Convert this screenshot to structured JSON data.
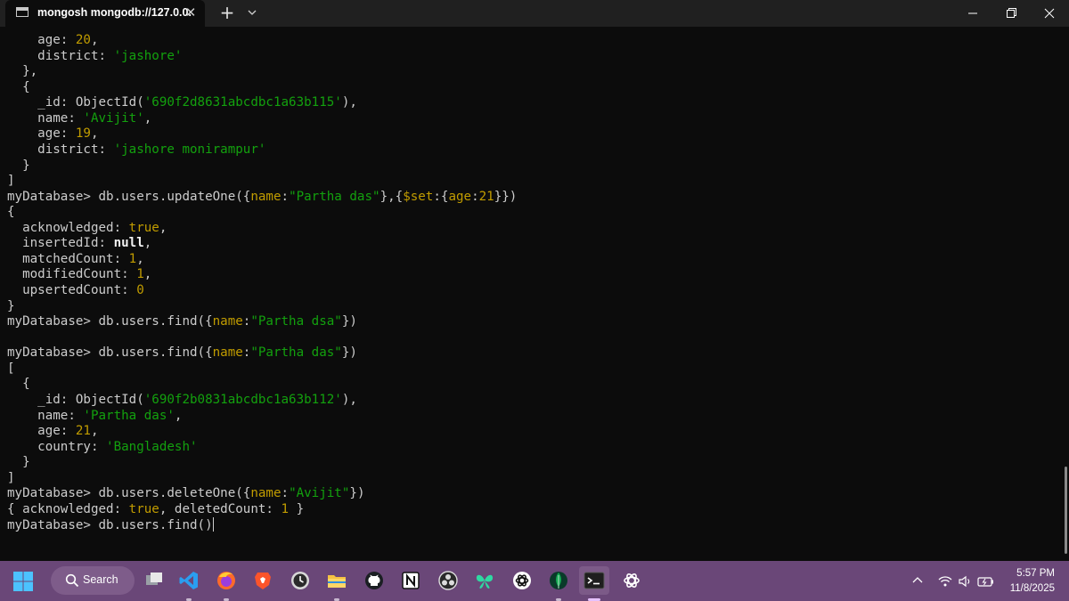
{
  "window": {
    "tab_title": "mongosh mongodb://127.0.0.",
    "close_tab_glyph": "✕",
    "new_tab_glyph": "+"
  },
  "terminal": {
    "lines": [
      [
        {
          "t": "    age: "
        },
        {
          "t": "20",
          "c": "num"
        },
        {
          "t": ","
        }
      ],
      [
        {
          "t": "    district: "
        },
        {
          "t": "'jashore'",
          "c": "str"
        }
      ],
      [
        {
          "t": "  },"
        }
      ],
      [
        {
          "t": "  {"
        }
      ],
      [
        {
          "t": "    _id: ObjectId("
        },
        {
          "t": "'690f2d8631abcdbc1a63b115'",
          "c": "str"
        },
        {
          "t": "),"
        }
      ],
      [
        {
          "t": "    name: "
        },
        {
          "t": "'Avijit'",
          "c": "str"
        },
        {
          "t": ","
        }
      ],
      [
        {
          "t": "    age: "
        },
        {
          "t": "19",
          "c": "num"
        },
        {
          "t": ","
        }
      ],
      [
        {
          "t": "    district: "
        },
        {
          "t": "'jashore monirampur'",
          "c": "str"
        }
      ],
      [
        {
          "t": "  }"
        }
      ],
      [
        {
          "t": "]"
        }
      ],
      [
        {
          "t": "myDatabase> db.users.updateOne({"
        },
        {
          "t": "name",
          "c": "key"
        },
        {
          "t": ":"
        },
        {
          "t": "\"Partha das\"",
          "c": "str"
        },
        {
          "t": "},{"
        },
        {
          "t": "$set",
          "c": "key"
        },
        {
          "t": ":{"
        },
        {
          "t": "age",
          "c": "key"
        },
        {
          "t": ":"
        },
        {
          "t": "21",
          "c": "num"
        },
        {
          "t": "}})"
        }
      ],
      [
        {
          "t": "{"
        }
      ],
      [
        {
          "t": "  acknowledged: "
        },
        {
          "t": "true",
          "c": "num"
        },
        {
          "t": ","
        }
      ],
      [
        {
          "t": "  insertedId: "
        },
        {
          "t": "null",
          "c": "bold"
        },
        {
          "t": ","
        }
      ],
      [
        {
          "t": "  matchedCount: "
        },
        {
          "t": "1",
          "c": "num"
        },
        {
          "t": ","
        }
      ],
      [
        {
          "t": "  modifiedCount: "
        },
        {
          "t": "1",
          "c": "num"
        },
        {
          "t": ","
        }
      ],
      [
        {
          "t": "  upsertedCount: "
        },
        {
          "t": "0",
          "c": "num"
        }
      ],
      [
        {
          "t": "}"
        }
      ],
      [
        {
          "t": "myDatabase> db.users.find({"
        },
        {
          "t": "name",
          "c": "key"
        },
        {
          "t": ":"
        },
        {
          "t": "\"Partha dsa\"",
          "c": "str"
        },
        {
          "t": "})"
        }
      ],
      [],
      [
        {
          "t": "myDatabase> db.users.find({"
        },
        {
          "t": "name",
          "c": "key"
        },
        {
          "t": ":"
        },
        {
          "t": "\"Partha das\"",
          "c": "str"
        },
        {
          "t": "})"
        }
      ],
      [
        {
          "t": "["
        }
      ],
      [
        {
          "t": "  {"
        }
      ],
      [
        {
          "t": "    _id: ObjectId("
        },
        {
          "t": "'690f2b0831abcdbc1a63b112'",
          "c": "str"
        },
        {
          "t": "),"
        }
      ],
      [
        {
          "t": "    name: "
        },
        {
          "t": "'Partha das'",
          "c": "str"
        },
        {
          "t": ","
        }
      ],
      [
        {
          "t": "    age: "
        },
        {
          "t": "21",
          "c": "num"
        },
        {
          "t": ","
        }
      ],
      [
        {
          "t": "    country: "
        },
        {
          "t": "'Bangladesh'",
          "c": "str"
        }
      ],
      [
        {
          "t": "  }"
        }
      ],
      [
        {
          "t": "]"
        }
      ],
      [
        {
          "t": "myDatabase> db.users.deleteOne({"
        },
        {
          "t": "name",
          "c": "key"
        },
        {
          "t": ":"
        },
        {
          "t": "\"Avijit\"",
          "c": "str"
        },
        {
          "t": "})"
        }
      ],
      [
        {
          "t": "{ acknowledged: "
        },
        {
          "t": "true",
          "c": "num"
        },
        {
          "t": ", deletedCount: "
        },
        {
          "t": "1",
          "c": "num"
        },
        {
          "t": " }"
        }
      ],
      [
        {
          "t": "myDatabase> db.users.find()"
        },
        {
          "cursor": true
        }
      ]
    ]
  },
  "colors": {
    "number": "#c19c00",
    "string": "#13a10e",
    "text": "#cccccc",
    "taskbar": "#6a4778"
  },
  "taskbar": {
    "search_label": "Search",
    "apps": [
      {
        "name": "task-view",
        "icon": "task-view-icon"
      },
      {
        "name": "vscode",
        "icon": "vscode-icon"
      },
      {
        "name": "firefox",
        "icon": "firefox-icon"
      },
      {
        "name": "brave",
        "icon": "brave-icon"
      },
      {
        "name": "clock",
        "icon": "clock-icon"
      },
      {
        "name": "file-explorer",
        "icon": "folder-icon"
      },
      {
        "name": "github-desktop",
        "icon": "github-icon"
      },
      {
        "name": "notion",
        "icon": "notion-icon"
      },
      {
        "name": "obs",
        "icon": "obs-icon"
      },
      {
        "name": "copilot",
        "icon": "butterfly-icon"
      },
      {
        "name": "chatgpt",
        "icon": "chatgpt-icon"
      },
      {
        "name": "mongodb-compass",
        "icon": "mongodb-leaf-icon"
      },
      {
        "name": "terminal",
        "icon": "terminal-icon"
      },
      {
        "name": "chatgpt-2",
        "icon": "chatgpt-icon"
      }
    ],
    "time": "5:57 PM",
    "date": "11/8/2025"
  }
}
